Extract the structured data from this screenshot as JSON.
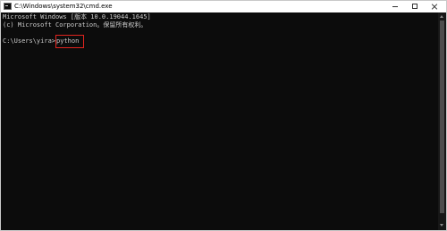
{
  "window": {
    "title": "C:\\Windows\\system32\\cmd.exe",
    "icon": "cmd-icon",
    "controls": {
      "minimize": "minimize-icon",
      "maximize": "maximize-icon",
      "close": "close-icon"
    }
  },
  "console": {
    "banner_line1": "Microsoft Windows [版本 10.0.19044.1645]",
    "banner_line2": "(c) Microsoft Corporation。保留所有权利。",
    "prompt": "C:\\Users\\yira>",
    "typed_command": "python",
    "highlight_color": "#e0241f",
    "text_color": "#cccccc",
    "background_color": "#0c0c0c"
  }
}
